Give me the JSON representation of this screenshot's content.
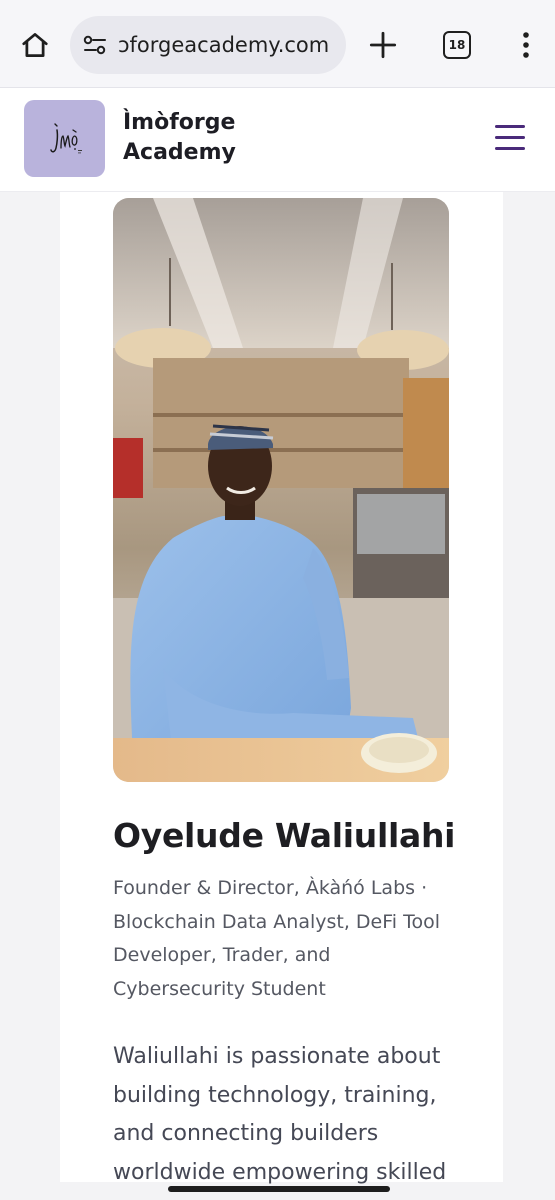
{
  "browser": {
    "url": "ɔforgeacademy.com",
    "tab_count": "18",
    "icons": {
      "home": "home-icon",
      "site_settings": "tune-icon",
      "new_tab": "plus-icon",
      "tabs": "tab-switcher-icon",
      "menu": "more-vert-icon"
    }
  },
  "site": {
    "name_line1": "Ìmòforge",
    "name_line2": "Academy",
    "logo_bg": "#b9b3dc",
    "accent": "#4a2a7a",
    "menu_icon": "hamburger-menu-icon"
  },
  "profile": {
    "name": "Oyelude Waliullahi",
    "role": "Founder & Director, Àkàńó Labs · Blockchain Data Analyst, DeFi Tool Developer, Trader, and Cybersecurity Student",
    "bio": "Waliullahi is passionate about building technology, training, and connecting builders worldwide empowering skilled"
  }
}
